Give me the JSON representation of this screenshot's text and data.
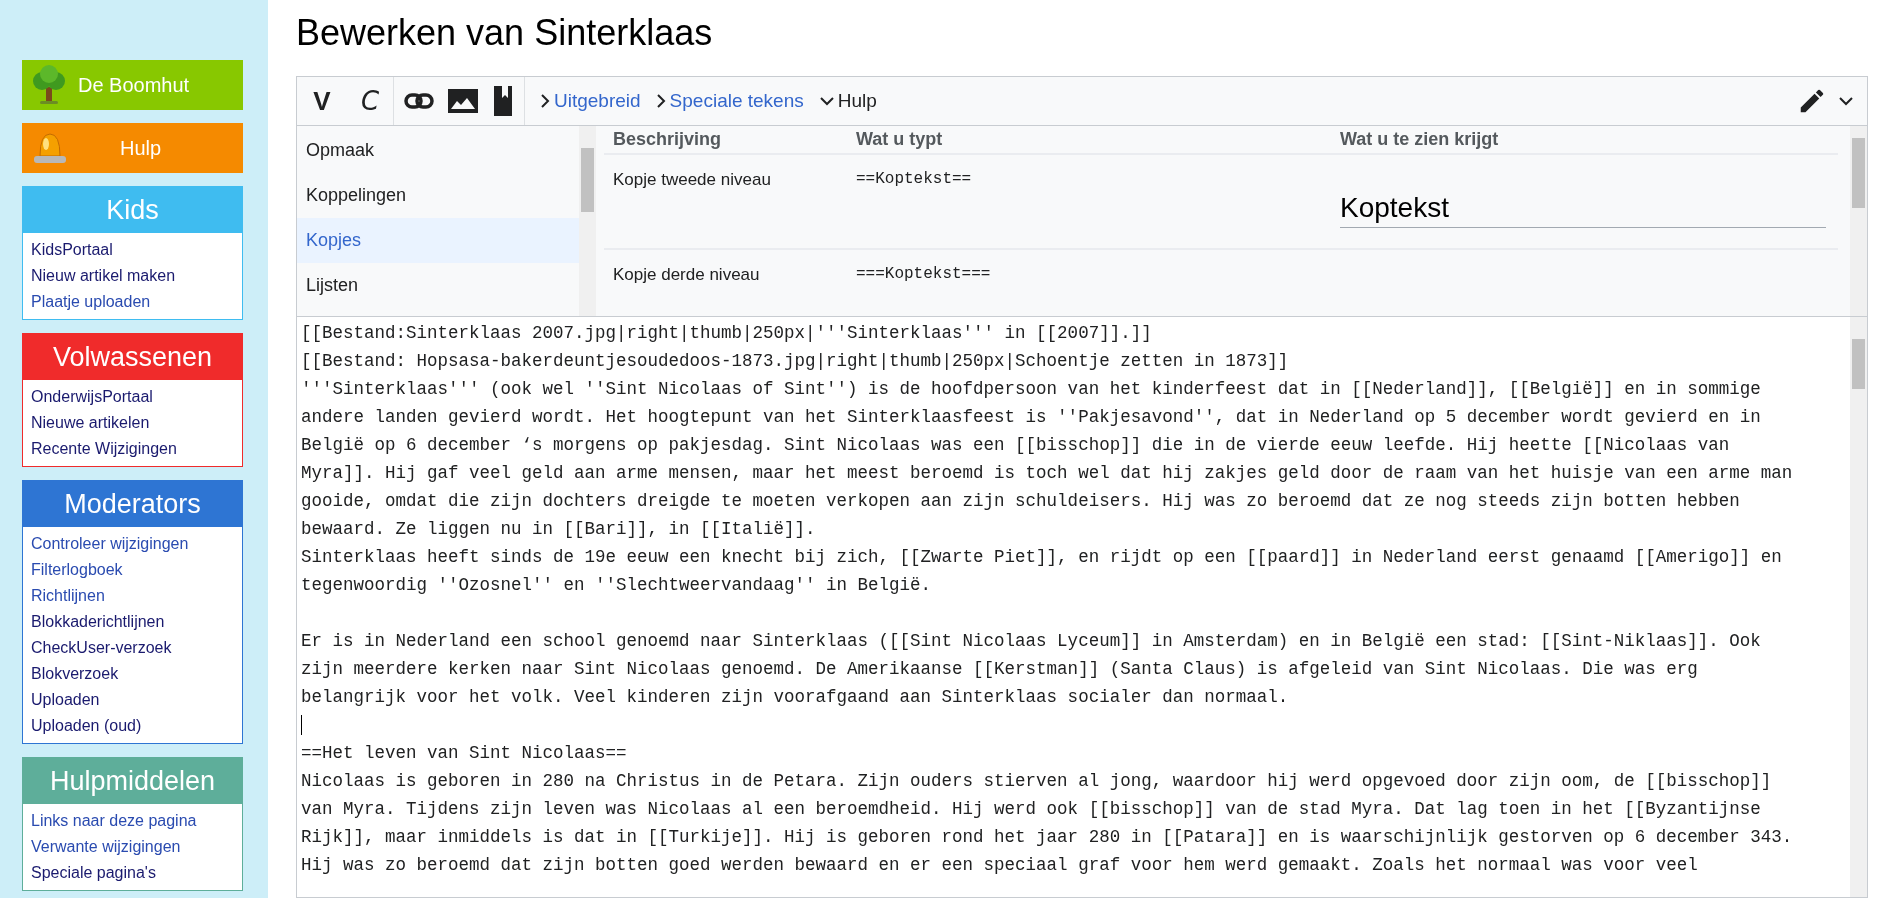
{
  "sidebar": {
    "buttons": [
      {
        "label": "De Boomhut",
        "color": "#88c800",
        "kind": "tree"
      },
      {
        "label": "Hulp",
        "color": "#f58a00",
        "kind": "beacon"
      }
    ],
    "boxes": [
      {
        "title": "Kids",
        "color": "#3fbcf0",
        "links": [
          {
            "label": "KidsPortaal",
            "visited": true
          },
          {
            "label": "Nieuw artikel maken",
            "visited": true
          },
          {
            "label": "Plaatje uploaden",
            "visited": false
          }
        ]
      },
      {
        "title": "Volwassenen",
        "color": "#f02b2b",
        "links": [
          {
            "label": "OnderwijsPortaal",
            "visited": true
          },
          {
            "label": "Nieuwe artikelen",
            "visited": true
          },
          {
            "label": "Recente Wijzigingen",
            "visited": true
          }
        ]
      },
      {
        "title": "Moderators",
        "color": "#2e75d3",
        "links": [
          {
            "label": "Controleer wijzigingen",
            "visited": false
          },
          {
            "label": "Filterlogboek",
            "visited": false
          },
          {
            "label": "Richtlijnen",
            "visited": false
          },
          {
            "label": "Blokkaderichtlijnen",
            "visited": true
          },
          {
            "label": "CheckUser-verzoek",
            "visited": true
          },
          {
            "label": "Blokverzoek",
            "visited": true
          },
          {
            "label": "Uploaden",
            "visited": true
          },
          {
            "label": "Uploaden (oud)",
            "visited": true
          }
        ]
      },
      {
        "title": "Hulpmiddelen",
        "color": "#5eae9a",
        "links": [
          {
            "label": "Links naar deze pagina",
            "visited": false
          },
          {
            "label": "Verwante wijzigingen",
            "visited": false
          },
          {
            "label": "Speciale pagina's",
            "visited": true
          }
        ]
      }
    ]
  },
  "page_title": "Bewerken van Sinterklaas",
  "toolbar": {
    "bold": "V",
    "italic": "C",
    "tabs": [
      {
        "label": "Uitgebreid",
        "expanded": false
      },
      {
        "label": "Speciale tekens",
        "expanded": false
      },
      {
        "label": "Hulp",
        "expanded": true
      }
    ]
  },
  "help": {
    "sections": [
      {
        "label": "Opmaak",
        "selected": false
      },
      {
        "label": "Koppelingen",
        "selected": false
      },
      {
        "label": "Kopjes",
        "selected": true
      },
      {
        "label": "Lijsten",
        "selected": false
      }
    ],
    "columns": [
      "Beschrijving",
      "Wat u typt",
      "Wat u te zien krijgt"
    ],
    "rows": [
      {
        "description": "Kopje tweede niveau",
        "input": "==Koptekst==",
        "result": "Koptekst"
      },
      {
        "description": "Kopje derde niveau",
        "input": "===Koptekst==="
      }
    ]
  },
  "editor": {
    "lines": [
      {
        "text": "[[Bestand:Sinterklaas 2007.jpg|right|thumb|250px|'''Sinterklaas''' in [[2007]].]]"
      },
      {
        "text": "[[Bestand: Hopsasa-bakerdeuntjesoudedoos-1873.jpg|right|thumb|250px|Schoentje zetten in 1873]]"
      },
      {
        "text": "'''Sinterklaas''' (ook wel ''Sint Nicolaas of Sint'') is de hoofdpersoon van het kinderfeest dat in [[Nederland]], [[België]] en in sommige"
      },
      {
        "text": "andere landen gevierd wordt. Het hoogtepunt van het Sinterklaasfeest is ''Pakjesavond'', dat in Nederland op 5 december wordt gevierd en in"
      },
      {
        "text": "België op 6 december ‘s morgens op pakjesdag. Sint Nicolaas was een [[bisschop]] die in de vierde eeuw leefde. Hij heette [[Nicolaas van"
      },
      {
        "text": "Myra]]. Hij gaf veel geld aan arme mensen, maar het meest beroemd is toch wel dat hij zakjes geld door de raam van het huisje van een arme man"
      },
      {
        "text": "gooide, omdat die zijn dochters dreigde te moeten verkopen aan zijn schuldeisers. Hij was zo beroemd dat ze nog steeds zijn botten hebben"
      },
      {
        "text": "bewaard. Ze liggen nu in [[Bari]], in [[Italië]]."
      },
      {
        "text": "Sinterklaas heeft sinds de 19e eeuw een knecht bij zich, [[Zwarte Piet]], en rijdt op een [[paard]] in Nederland eerst genaamd [[Amerigo]] en"
      },
      {
        "text": "tegenwoordig ''Ozosnel'' en ''Slechtweervandaag'' in België."
      },
      {
        "kind": "blank"
      },
      {
        "text": "Er is in Nederland een school genoemd naar Sinterklaas ([[Sint Nicolaas Lyceum]] in Amsterdam) en in België een stad: [[Sint-Niklaas]]. Ook"
      },
      {
        "text": "zijn meerdere kerken naar Sint Nicolaas genoemd. De Amerikaanse [[Kerstman]] (Santa Claus) is afgeleid van Sint Nicolaas. Die was erg"
      },
      {
        "text": "belangrijk voor het volk. Veel kinderen zijn voorafgaand aan Sinterklaas socialer dan normaal."
      },
      {
        "kind": "cursor"
      },
      {
        "text": "==Het leven van Sint Nicolaas=="
      },
      {
        "text": "Nicolaas is geboren in 280 na Christus in de Petara. Zijn ouders stierven al jong, waardoor hij werd opgevoed door zijn oom, de [[bisschop]]"
      },
      {
        "text": "van Myra. Tijdens zijn leven was Nicolaas al een beroemdheid. Hij werd ook [[bisschop]] van de stad Myra. Dat lag toen in het [[Byzantijnse"
      },
      {
        "text": "Rijk]], maar inmiddels is dat in [[Turkije]]. Hij is geboren rond het jaar 280 in [[Patara]] en is waarschijnlijk gestorven op 6 december 343."
      },
      {
        "text": "Hij was zo beroemd dat zijn botten goed werden bewaard en er een speciaal graf voor hem werd gemaakt. Zoals het normaal was voor veel"
      }
    ]
  }
}
